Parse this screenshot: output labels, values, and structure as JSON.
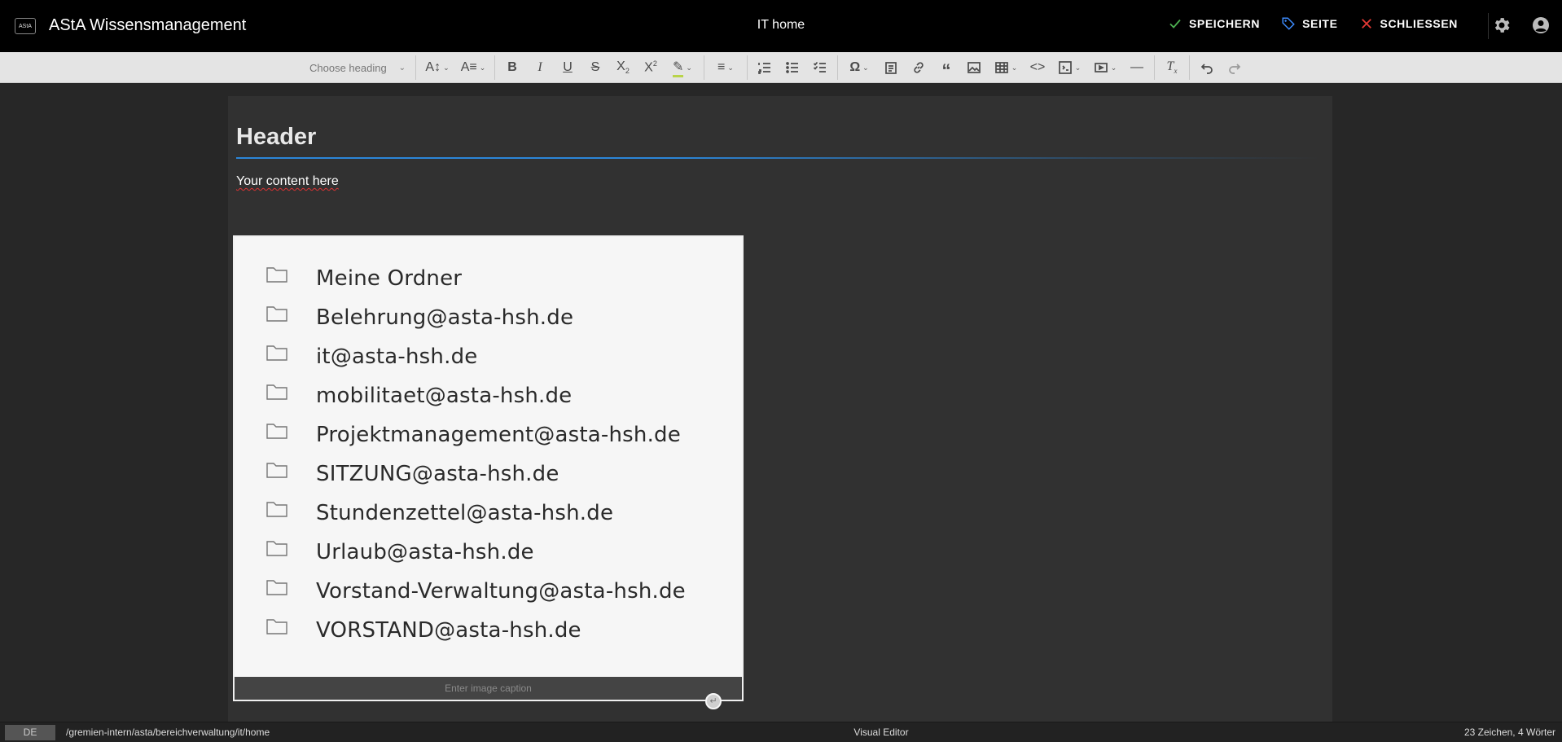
{
  "app": {
    "title": "AStA Wissensmanagement",
    "logo_text": "AStA"
  },
  "page": {
    "title": "IT home"
  },
  "actions": {
    "save": "SPEICHERN",
    "page": "SEITE",
    "close": "SCHLIESSEN"
  },
  "colors": {
    "save": "#4caf50",
    "page": "#3d8bfd",
    "close": "#e53935",
    "heading_rule": "#2b86d8"
  },
  "toolbar": {
    "heading_placeholder": "Choose heading",
    "buttons": [
      "font-size",
      "font-family",
      "bold",
      "italic",
      "underline",
      "strikethrough",
      "subscript",
      "superscript",
      "highlight",
      "align",
      "numbered-list",
      "bulleted-list",
      "todo-list",
      "special-characters",
      "paste-from-office",
      "link",
      "blockquote",
      "image",
      "table",
      "code",
      "code-block",
      "media",
      "horizontal-line",
      "remove-format",
      "undo",
      "redo"
    ]
  },
  "editor": {
    "heading": "Header",
    "paragraph": "Your content here",
    "image_caption_placeholder": "Enter image caption",
    "folders": [
      {
        "name": "Meine Ordner",
        "crossed": false
      },
      {
        "name": "Belehrung@asta-hsh.de",
        "crossed": false
      },
      {
        "name": "it@asta-hsh.de",
        "crossed": true
      },
      {
        "name": "mobilitaet@asta-hsh.de",
        "crossed": true
      },
      {
        "name": "Projektmanagement@asta-hsh.de",
        "crossed": true
      },
      {
        "name": "SITZUNG@asta-hsh.de",
        "crossed": false
      },
      {
        "name": "Stundenzettel@asta-hsh.de",
        "crossed": false
      },
      {
        "name": "Urlaub@asta-hsh.de",
        "crossed": false
      },
      {
        "name": "Vorstand-Verwaltung@asta-hsh.de",
        "crossed": true
      },
      {
        "name": "VORSTAND@asta-hsh.de",
        "crossed": false
      }
    ]
  },
  "status": {
    "language": "DE",
    "path": "/gremien-intern/asta/bereichverwaltung/it/home",
    "mode": "Visual Editor",
    "count": "23 Zeichen, 4 Wörter"
  }
}
